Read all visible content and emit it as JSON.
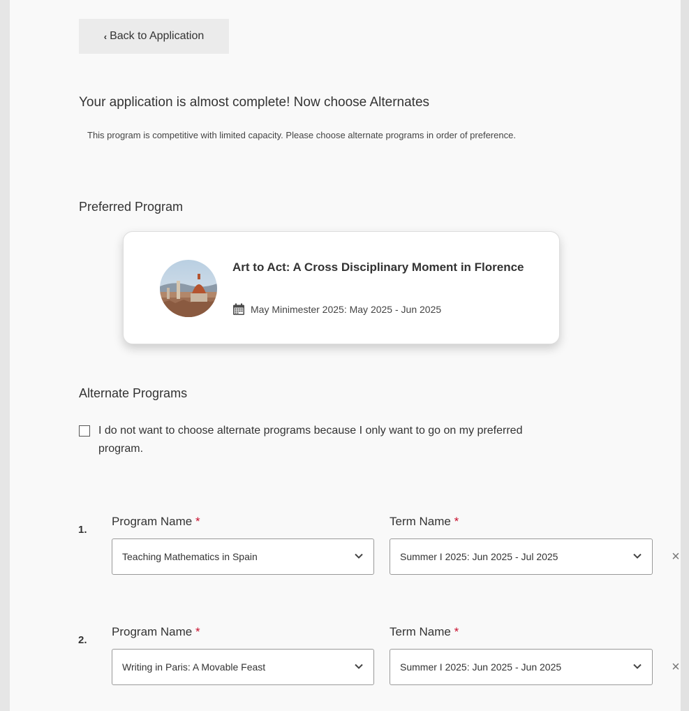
{
  "nav": {
    "back_label": "Back to Application"
  },
  "intro": {
    "heading": "Your application is almost complete! Now choose Alternates",
    "description": "This program is competitive with limited capacity. Please choose alternate programs in order of preference."
  },
  "preferred": {
    "section_title": "Preferred Program",
    "program_title": "Art to Act: A Cross Disciplinary Moment in Florence",
    "term": "May Minimester 2025: May 2025 - Jun 2025",
    "thumbnail_icon": "florence-cathedral-photo"
  },
  "alternates": {
    "section_title": "Alternate Programs",
    "opt_out_label": "I do not want to choose alternate programs because I only want to go on my preferred program.",
    "opt_out_checked": false,
    "program_label": "Program Name",
    "term_label": "Term Name",
    "required_mark": "*",
    "items": [
      {
        "number": "1.",
        "program": "Teaching Mathematics in Spain",
        "term": "Summer I 2025: Jun 2025 - Jul 2025"
      },
      {
        "number": "2.",
        "program": "Writing in Paris: A Movable Feast",
        "term": "Summer I 2025: Jun 2025 - Jun 2025"
      }
    ],
    "remove_glyph": "×"
  },
  "colors": {
    "required": "#c8102e",
    "panel_bg": "#f9f9f9",
    "page_bg": "#e6e6e6"
  }
}
